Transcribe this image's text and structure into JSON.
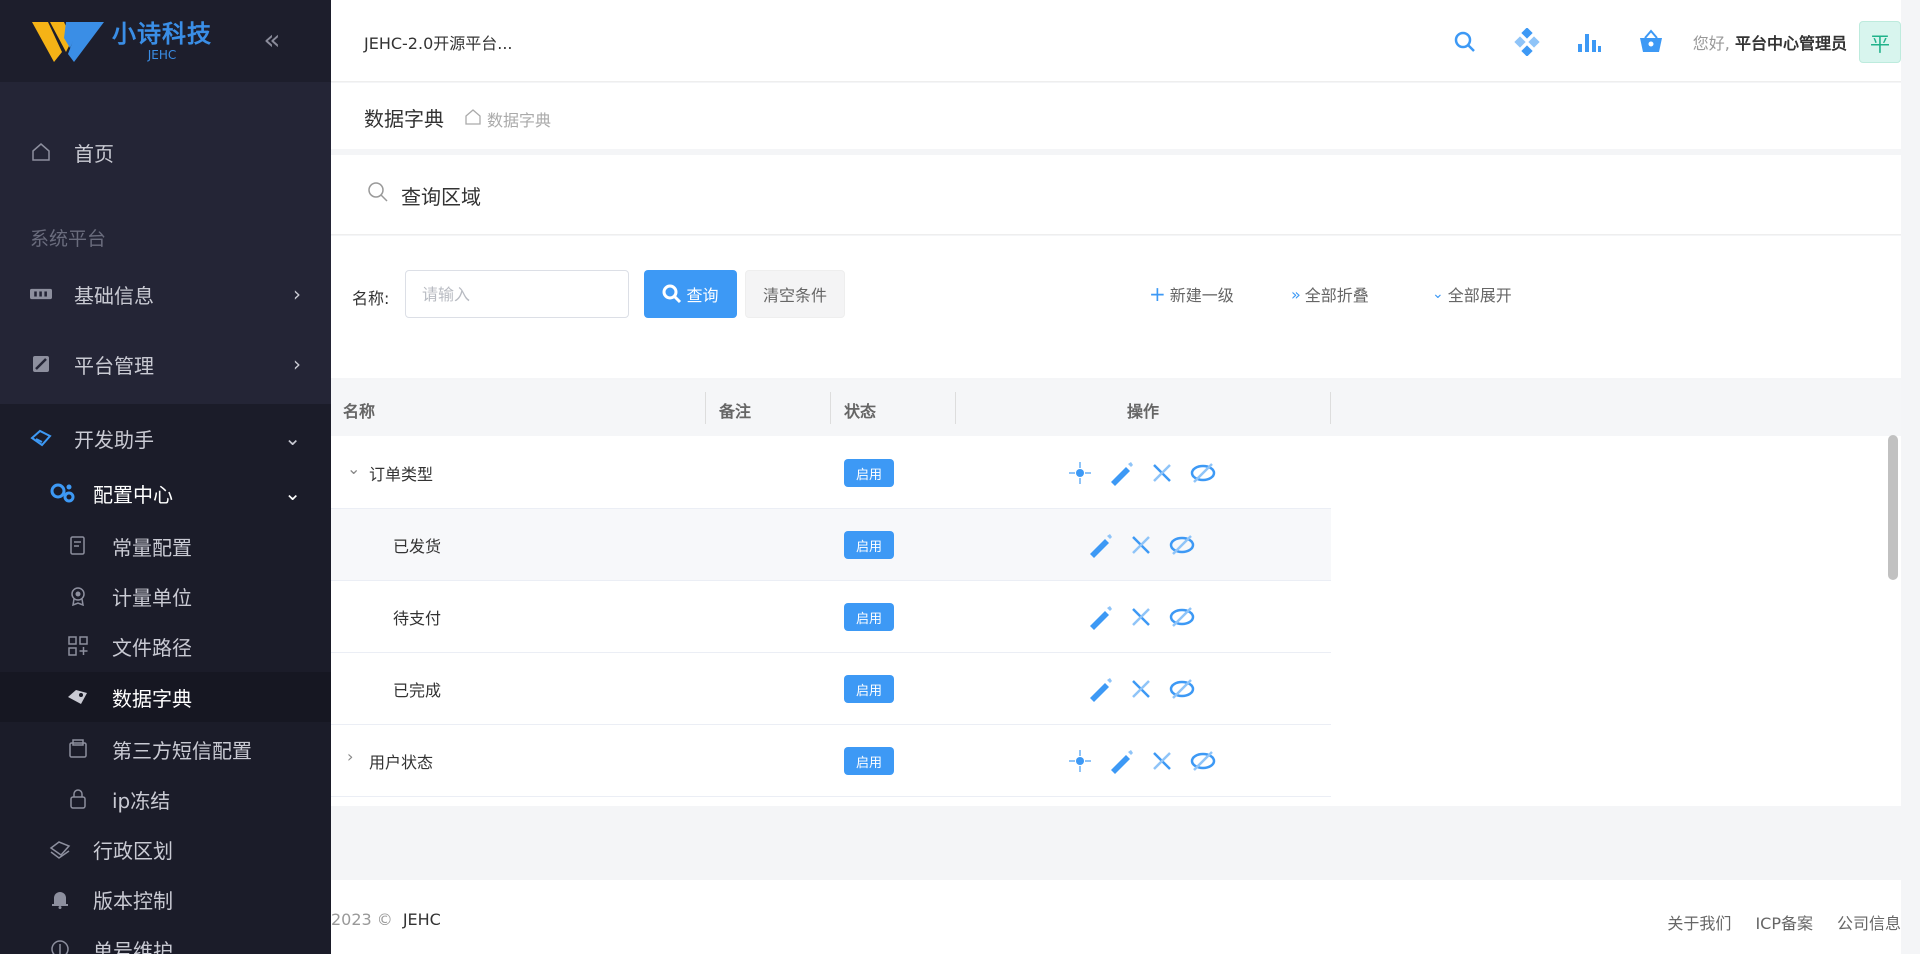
{
  "logo": {
    "title": "小诗科技",
    "sub": "JEHC"
  },
  "sidebar": {
    "home": "首页",
    "section": "系统平台",
    "items": [
      {
        "label": "基础信息",
        "icon": "grid-icon"
      },
      {
        "label": "平台管理",
        "icon": "config-icon"
      },
      {
        "label": "开发助手",
        "icon": "hand-icon"
      }
    ],
    "config_center": "配置中心",
    "sub_items": [
      "常量配置",
      "计量单位",
      "文件路径",
      "数据字典",
      "第三方短信配置",
      "ip冻结"
    ],
    "more_items": [
      "行政区划",
      "版本控制",
      "单号维护"
    ]
  },
  "header": {
    "title": "JEHC-2.0开源平台...",
    "greeting": "您好,",
    "user": "平台中心管理员",
    "avatar": "平"
  },
  "breadcrumb": {
    "title": "数据字典",
    "path": "数据字典"
  },
  "query": {
    "title": "查询区域",
    "name_label": "名称:",
    "placeholder": "请输入",
    "search_btn": "查询",
    "clear_btn": "清空条件",
    "new_btn": "新建一级",
    "collapse_all": "全部折叠",
    "expand_all": "全部展开"
  },
  "table": {
    "columns": [
      "名称",
      "备注",
      "状态",
      "操作"
    ],
    "rows": [
      {
        "name": "订单类型",
        "status": "启用",
        "level": 0,
        "expanded": true
      },
      {
        "name": "已发货",
        "status": "启用",
        "level": 1
      },
      {
        "name": "待支付",
        "status": "启用",
        "level": 1
      },
      {
        "name": "已完成",
        "status": "启用",
        "level": 1
      },
      {
        "name": "用户状态",
        "status": "启用",
        "level": 0,
        "expanded": false
      }
    ]
  },
  "footer": {
    "copyright": "2023 ©",
    "brand": "JEHC",
    "links": [
      "关于我们",
      "ICP备案",
      "公司信息"
    ]
  },
  "colors": {
    "primary": "#3d99f5",
    "sidebar": "#242536",
    "avatar_bg": "#d8f5ee"
  }
}
